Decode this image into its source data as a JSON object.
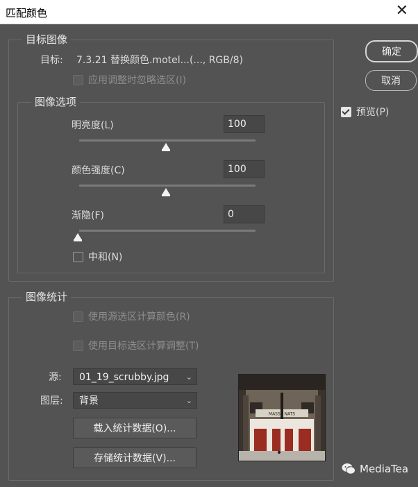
{
  "window": {
    "title": "匹配颜色",
    "close_glyph": "✕"
  },
  "buttons": {
    "ok": "确定",
    "cancel": "取消"
  },
  "preview": {
    "label": "预览(P)",
    "checked": true
  },
  "target_section": {
    "legend": "目标图像",
    "target_label": "目标:",
    "target_value": "7.3.21 替换颜色.motel...(..., RGB/8)",
    "ignore_selection": "应用调整时忽略选区(I)"
  },
  "options_section": {
    "legend": "图像选项",
    "luminance": {
      "label": "明亮度(L)",
      "value": "100",
      "slider_fraction": 0.5
    },
    "intensity": {
      "label": "颜色强度(C)",
      "value": "100",
      "slider_fraction": 0.5
    },
    "fade": {
      "label": "渐隐(F)",
      "value": "0",
      "slider_fraction": 0.0
    },
    "neutralize": "中和(N)"
  },
  "stats_section": {
    "legend": "图像统计",
    "use_source_selection": "使用源选区计算颜色(R)",
    "use_target_selection": "使用目标选区计算调整(T)",
    "source_label": "源:",
    "source_value": "01_19_scrubby.jpg",
    "layer_label": "图层:",
    "layer_value": "背景",
    "load_button": "载入统计数据(O)...",
    "save_button": "存储统计数据(V)..."
  },
  "thumbnail": {
    "sign_text": "MASSE NATS"
  },
  "watermark": {
    "text": "MediaTea",
    "icon": "wechat-icon"
  }
}
